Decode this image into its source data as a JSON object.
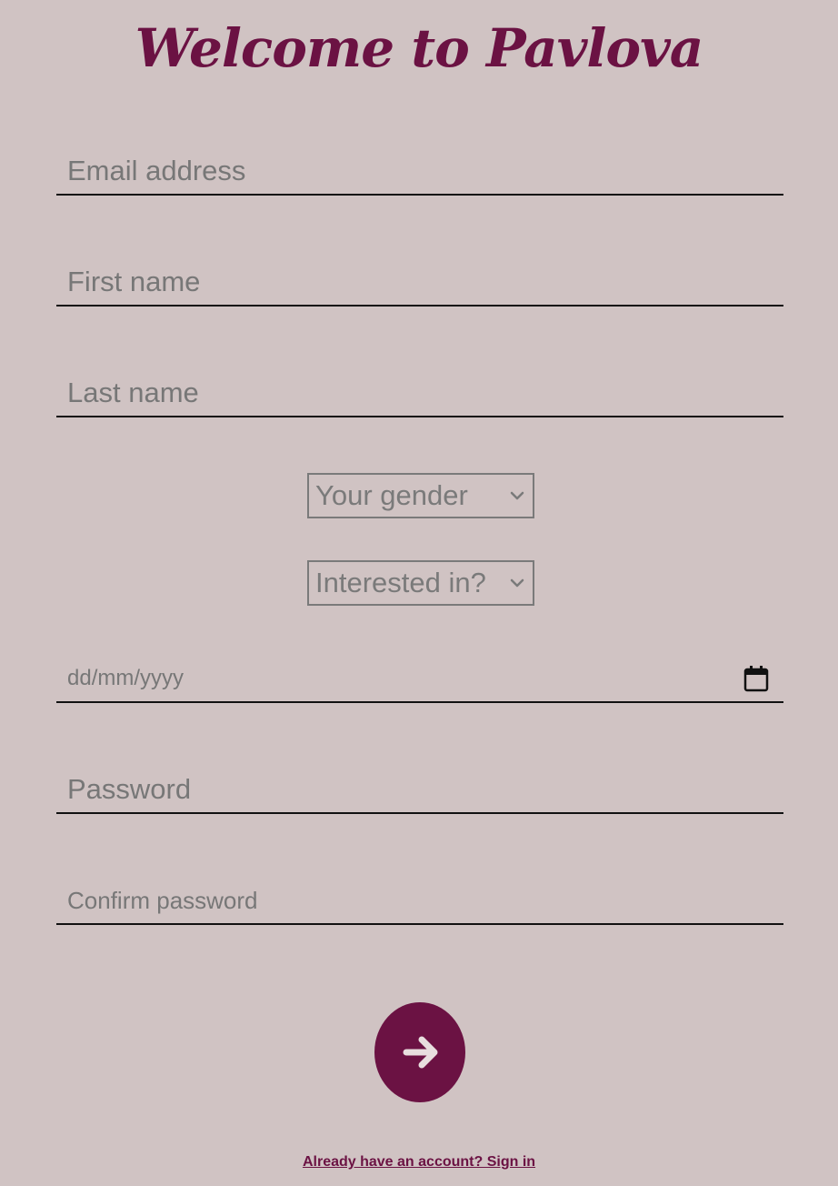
{
  "header": {
    "title": "Welcome to Pavlova"
  },
  "form": {
    "email": {
      "placeholder": "Email address",
      "value": ""
    },
    "first_name": {
      "placeholder": "First name",
      "value": ""
    },
    "last_name": {
      "placeholder": "Last name",
      "value": ""
    },
    "gender": {
      "selected": "Your gender"
    },
    "interested_in": {
      "selected": "Interested in?"
    },
    "birth_date": {
      "placeholder": "dd/mm/yyyy",
      "value": ""
    },
    "password": {
      "placeholder": "Password",
      "value": ""
    },
    "confirm_password": {
      "placeholder": "Confirm password",
      "value": ""
    },
    "submit_icon": "arrow-right-icon"
  },
  "footer": {
    "signin_link": "Already have an account? Sign in"
  },
  "colors": {
    "background": "#d0c3c3",
    "accent": "#6b1243",
    "placeholder": "#777777"
  }
}
